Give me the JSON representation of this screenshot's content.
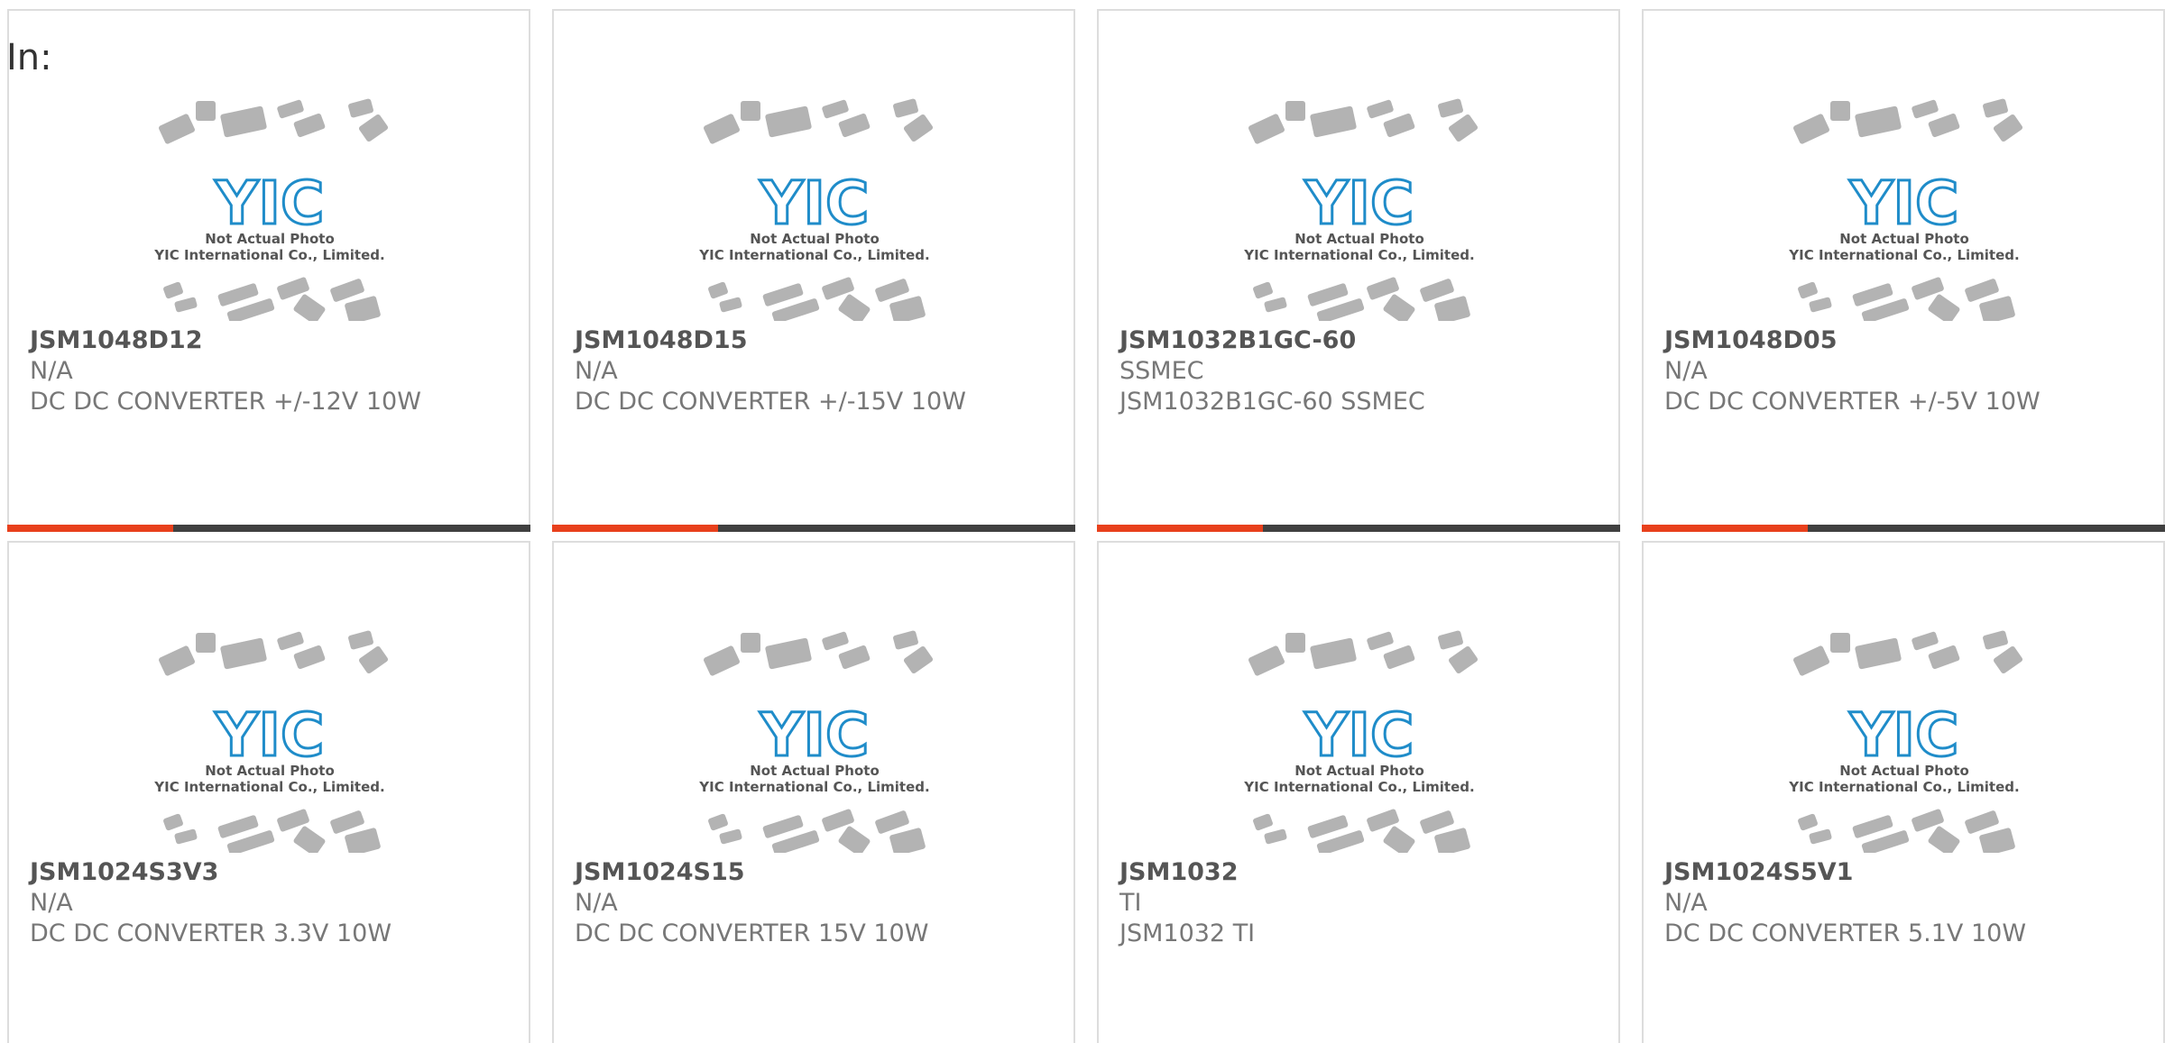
{
  "page": {
    "in_label": "In:"
  },
  "colors": {
    "bar_accent": "#e8401c",
    "bar_rest": "#404040",
    "logo_blue": "#1f8cc9",
    "chip_gray": "#b3b3b3"
  },
  "placeholder": {
    "logo_text": "YIC",
    "line1": "Not Actual Photo",
    "line2": "YIC International Co., Limited."
  },
  "products": [
    {
      "part": "JSM1048D12",
      "manufacturer": "N/A",
      "description": "DC DC CONVERTER +/-12V 10W"
    },
    {
      "part": "JSM1048D15",
      "manufacturer": "N/A",
      "description": "DC DC CONVERTER +/-15V 10W"
    },
    {
      "part": "JSM1032B1GC-60",
      "manufacturer": "SSMEC",
      "description": "JSM1032B1GC-60 SSMEC"
    },
    {
      "part": "JSM1048D05",
      "manufacturer": "N/A",
      "description": "DC DC CONVERTER +/-5V 10W"
    },
    {
      "part": "JSM1024S3V3",
      "manufacturer": "N/A",
      "description": "DC DC CONVERTER 3.3V 10W"
    },
    {
      "part": "JSM1024S15",
      "manufacturer": "N/A",
      "description": "DC DC CONVERTER 15V 10W"
    },
    {
      "part": "JSM1032",
      "manufacturer": "TI",
      "description": "JSM1032 TI"
    },
    {
      "part": "JSM1024S5V1",
      "manufacturer": "N/A",
      "description": "DC DC CONVERTER 5.1V 10W"
    }
  ]
}
